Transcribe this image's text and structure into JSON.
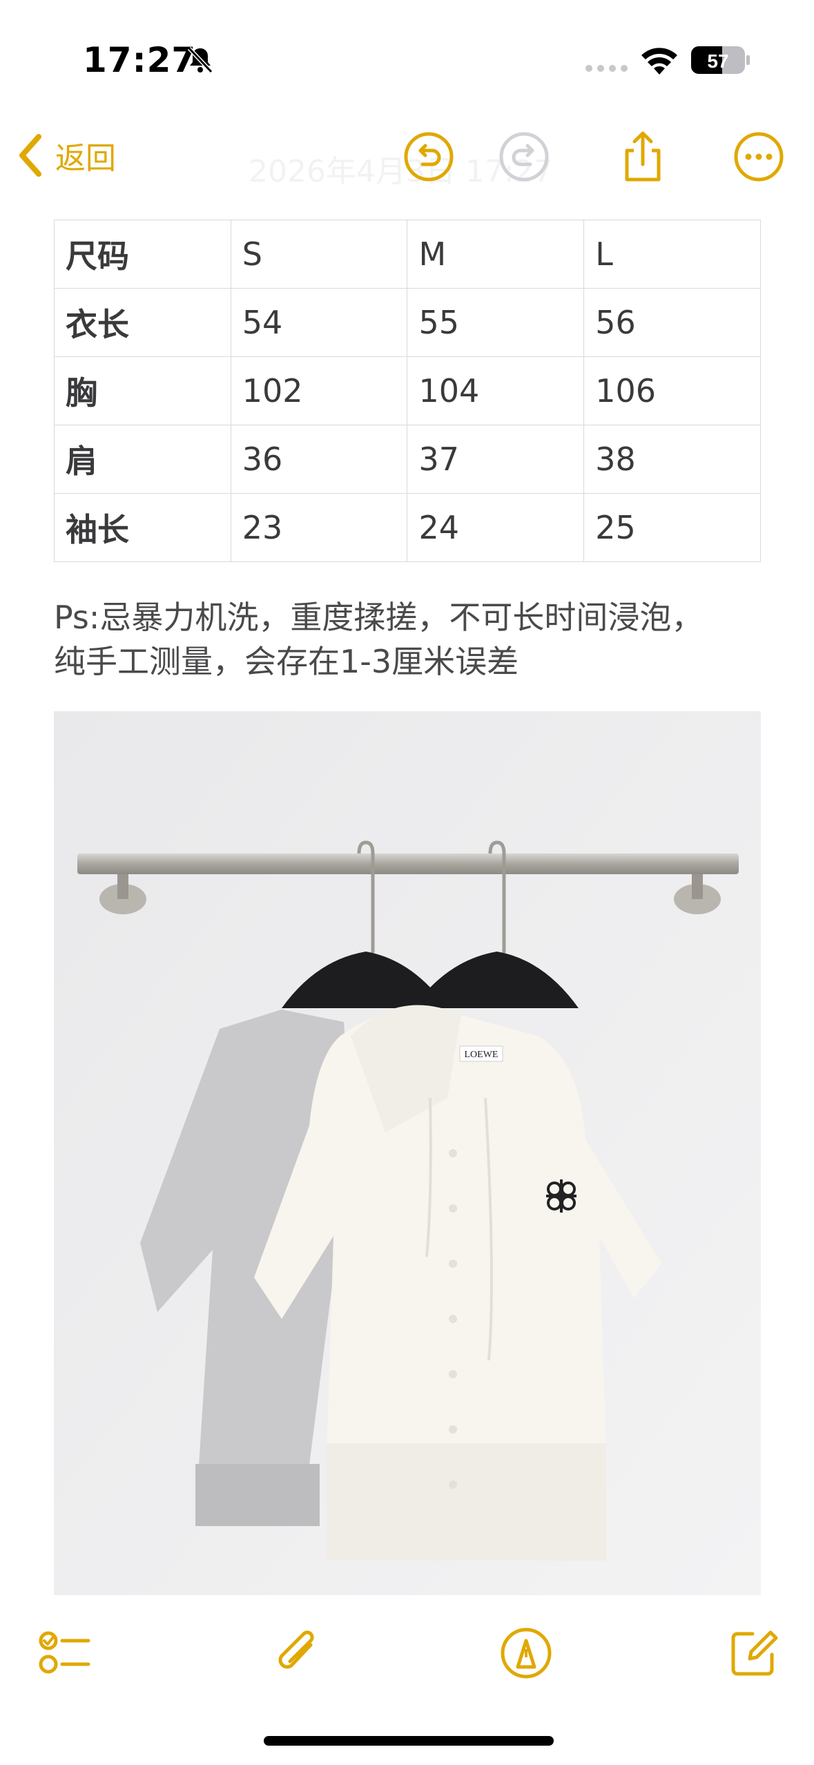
{
  "status_bar": {
    "time": "17:27",
    "battery": "57"
  },
  "nav": {
    "back_label": "返回",
    "ghost_title": "2026年4月3日 17:27"
  },
  "size_table": {
    "rows": [
      [
        "尺码",
        "S",
        "M",
        "L"
      ],
      [
        "衣长",
        "54",
        "55",
        "56"
      ],
      [
        "胸",
        "102",
        "104",
        "106"
      ],
      [
        "肩",
        "36",
        "37",
        "38"
      ],
      [
        "袖长",
        "23",
        "24",
        "25"
      ]
    ]
  },
  "note": {
    "line1": "Ps:忌暴力机洗，重度揉搓，不可长时间浸泡，",
    "line2": "纯手工测量，会存在1-3厘米误差"
  },
  "photo": {
    "label_text": "LOEWE"
  },
  "colors": {
    "accent": "#e0a800",
    "text": "#3a3a3c",
    "grid": "#d9d9de"
  },
  "icons": {
    "back": "chevron-left-icon",
    "undo": "undo-icon",
    "redo": "redo-icon",
    "share": "share-icon",
    "more": "ellipsis-icon",
    "checklist": "checklist-icon",
    "attach": "paperclip-icon",
    "markup": "markup-pen-icon",
    "compose": "compose-icon"
  }
}
